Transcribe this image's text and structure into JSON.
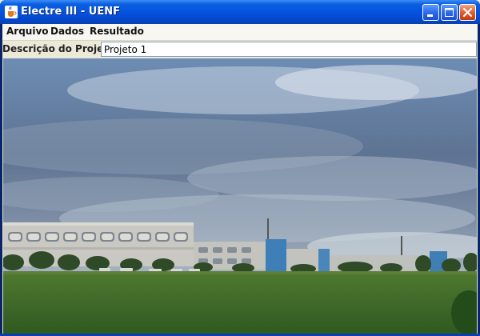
{
  "window": {
    "title": "Electre III - UENF",
    "app_icon": "java-cup-icon",
    "controls": [
      "minimize-icon",
      "maximize-icon",
      "close-icon"
    ],
    "colors": {
      "titlebar": "#0553DF",
      "close": "#E05E30",
      "client_bg": "#ECE9D8"
    }
  },
  "menubar": {
    "items": [
      {
        "label": "Arquivo"
      },
      {
        "label": "Dados"
      },
      {
        "label": "Resultado"
      }
    ]
  },
  "project": {
    "label": "Descrição do Projeto",
    "value": "Projeto 1"
  }
}
